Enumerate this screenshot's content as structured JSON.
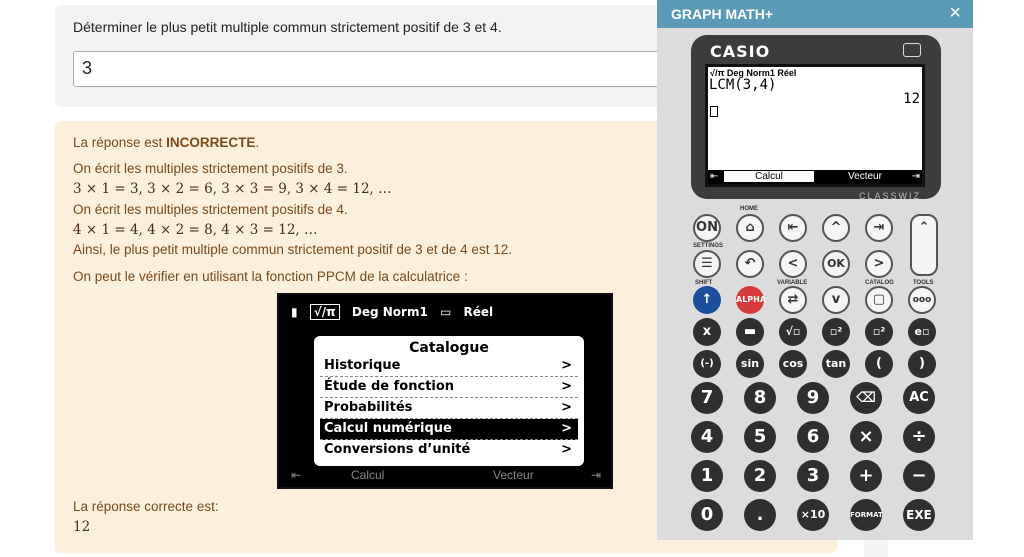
{
  "question": {
    "text": "Déterminer le plus petit multiple commun strictement positif de 3 et 4.",
    "answer_value": "3"
  },
  "feedback": {
    "verdict_prefix": "La réponse est ",
    "verdict_word": "INCORRECTE",
    "verdict_suffix": ".",
    "line1": "On écrit les multiples strictement positifs de 3.",
    "line2": "3 × 1 = 3, 3 × 2 = 6, 3 × 3 = 9, 3 × 4 = 12, …",
    "line3": "On écrit les multiples strictement positifs de 4.",
    "line4": "4 × 1 = 4, 4 × 2 = 8, 4 × 3 = 12, …",
    "line5": "Ainsi, le plus petit multiple commun strictement positif de 3 et de 4 est 12.",
    "line6": "On peut le vérifier en utilisant la fonction PPCM de la calculatrice :",
    "correct_label": "La réponse correcte est:",
    "correct_value": "12"
  },
  "calc_screenshot": {
    "status_mode": "√/π",
    "status_angle": "Deg Norm1",
    "status_complex": "Réel",
    "menu_title": "Catalogue",
    "items": [
      "Historique",
      "Étude de fonction",
      "Probabilités",
      "Calcul numérique",
      "Conversions d’unité"
    ],
    "selected_index": 3,
    "arrow": ">",
    "soft_left": "Calcul",
    "soft_right": "Vecteur"
  },
  "calc_panel": {
    "title": "GRAPH MATH+",
    "close": "×",
    "brand": "CASIO",
    "lcd_status": "√/π  Deg Norm1   Réel",
    "lcd_expression": "LCM(3,4)",
    "lcd_result": "12",
    "soft_left": "Calcul",
    "soft_right": "Vecteur",
    "model": "CLASSWIZ",
    "keys": {
      "on": "ON",
      "home": "⌂",
      "back": "⇤",
      "up": "^",
      "forward": "⇥",
      "scroll_up": "⌃",
      "settings": "☰",
      "undo": "↶",
      "left": "<",
      "ok": "OK",
      "right": ">",
      "scroll_down": "⌄",
      "shift": "↑",
      "alpha": "ALPHA",
      "var": "⇄",
      "down": "v",
      "catalog": "▢",
      "tools": "ooo",
      "x": "x",
      "frac": "▬",
      "sqrt": "√▫",
      "pow": "▫²",
      "pow2": "▫²",
      "exp": "e▫",
      "neg": "(-)",
      "sin": "sin",
      "cos": "cos",
      "tan": "tan",
      "lpar": "(",
      "rpar": ")",
      "k7": "7",
      "k8": "8",
      "k9": "9",
      "del": "⌫",
      "ac": "AC",
      "k4": "4",
      "k5": "5",
      "k6": "6",
      "mul": "×",
      "div": "÷",
      "k1": "1",
      "k2": "2",
      "k3": "3",
      "add": "+",
      "sub": "−",
      "k0": "0",
      "dot": ".",
      "x10": "×10",
      "format": "FORMAT",
      "exe": "EXE"
    }
  }
}
